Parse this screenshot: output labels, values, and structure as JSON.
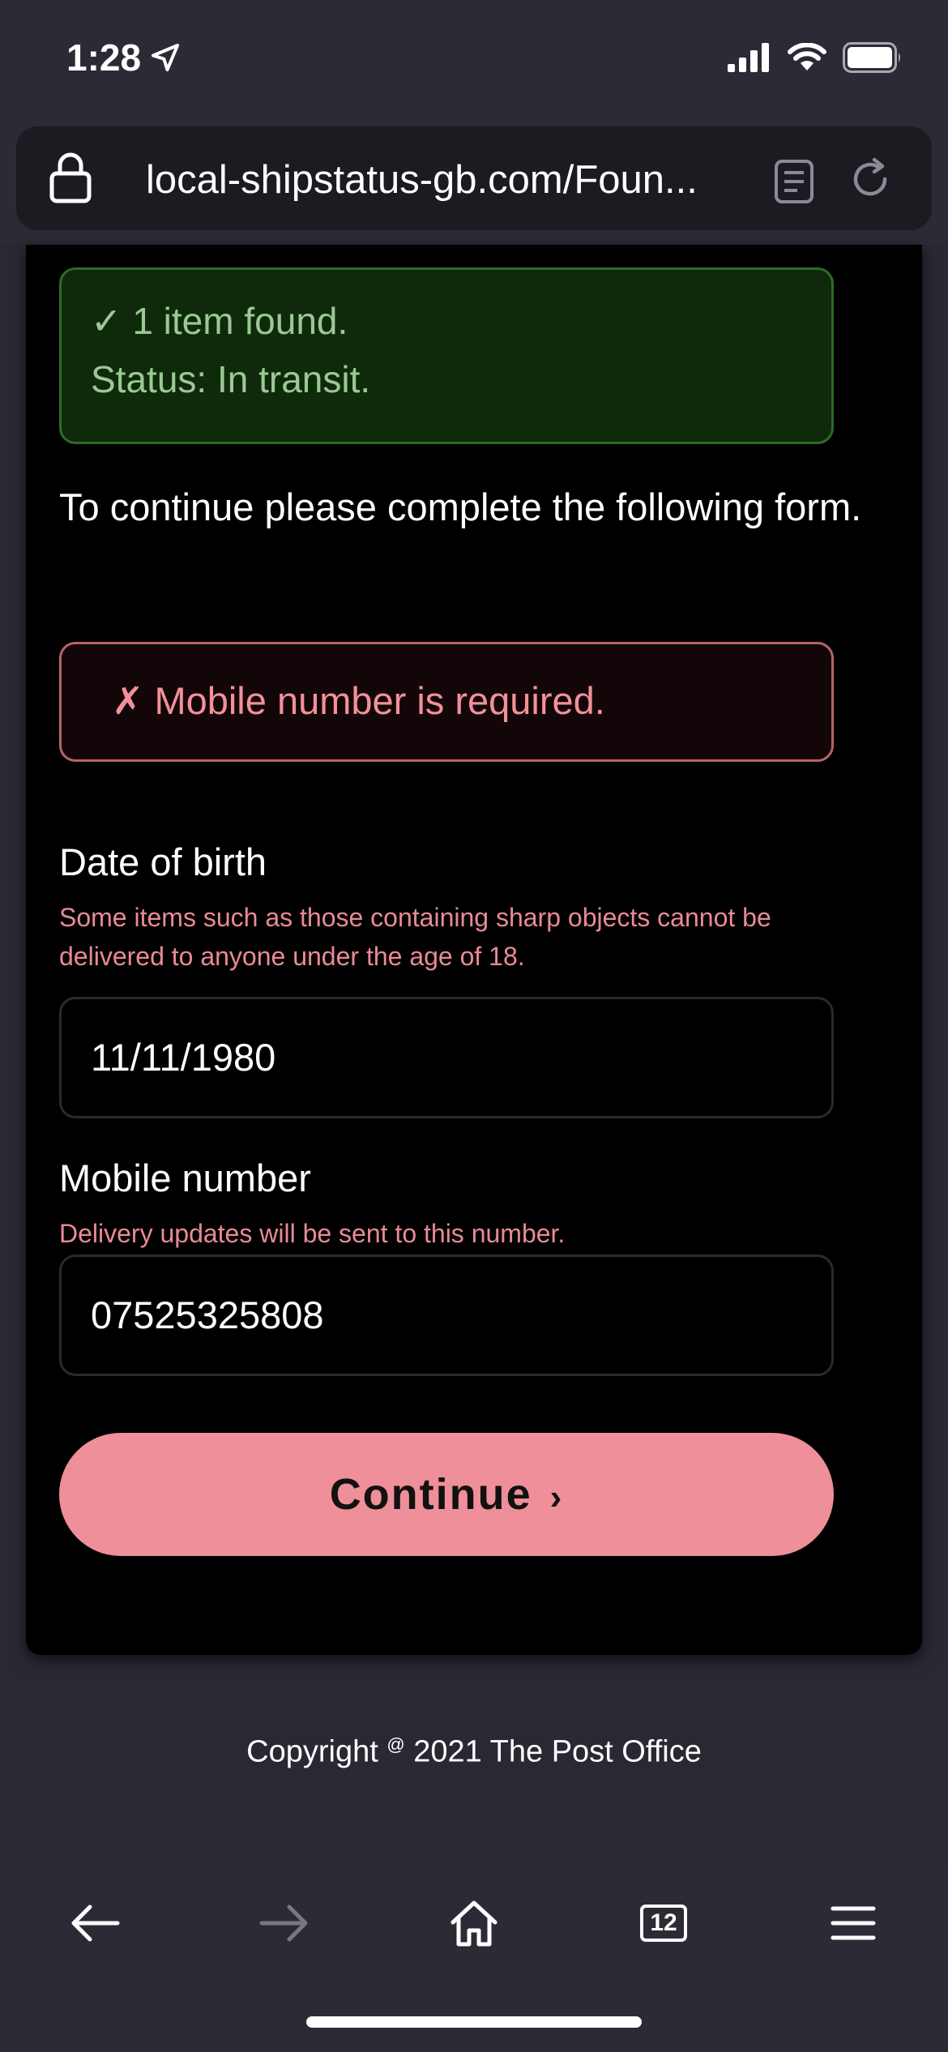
{
  "status_bar": {
    "time": "1:28"
  },
  "browser": {
    "url": "local-shipstatus-gb.com/Foun...",
    "tab_count": "12"
  },
  "page": {
    "success": {
      "line1": "✓ 1 item found.",
      "line2": "Status: In transit."
    },
    "instruction": "To continue please complete the following form.",
    "error": "✗ Mobile number is required.",
    "dob": {
      "label": "Date of birth",
      "hint": "Some items such as those containing sharp objects cannot be delivered to anyone under the age of 18.",
      "value": "11/11/1980"
    },
    "mobile": {
      "label": "Mobile number",
      "hint": "Delivery updates will be sent to this number.",
      "value": "07525325808"
    },
    "continue_label": "Continue",
    "copyright_prefix": "Copyright",
    "copyright_symbol": "@",
    "copyright_suffix": "2021 The Post Office"
  },
  "colors": {
    "success_bg": "#0e2a0a",
    "success_text": "#9bc894",
    "error_border": "#b86269",
    "error_text": "#f2909a",
    "button": "#ef8f99"
  },
  "icons": {
    "location": "location-arrow-icon",
    "signal": "cellular-signal-icon",
    "wifi": "wifi-icon",
    "battery": "battery-icon",
    "lock": "lock-icon",
    "reader": "reader-mode-icon",
    "reload": "reload-icon",
    "back": "back-arrow-icon",
    "forward": "forward-arrow-icon",
    "home": "home-icon",
    "tabs": "tabs-icon",
    "menu": "menu-icon"
  }
}
